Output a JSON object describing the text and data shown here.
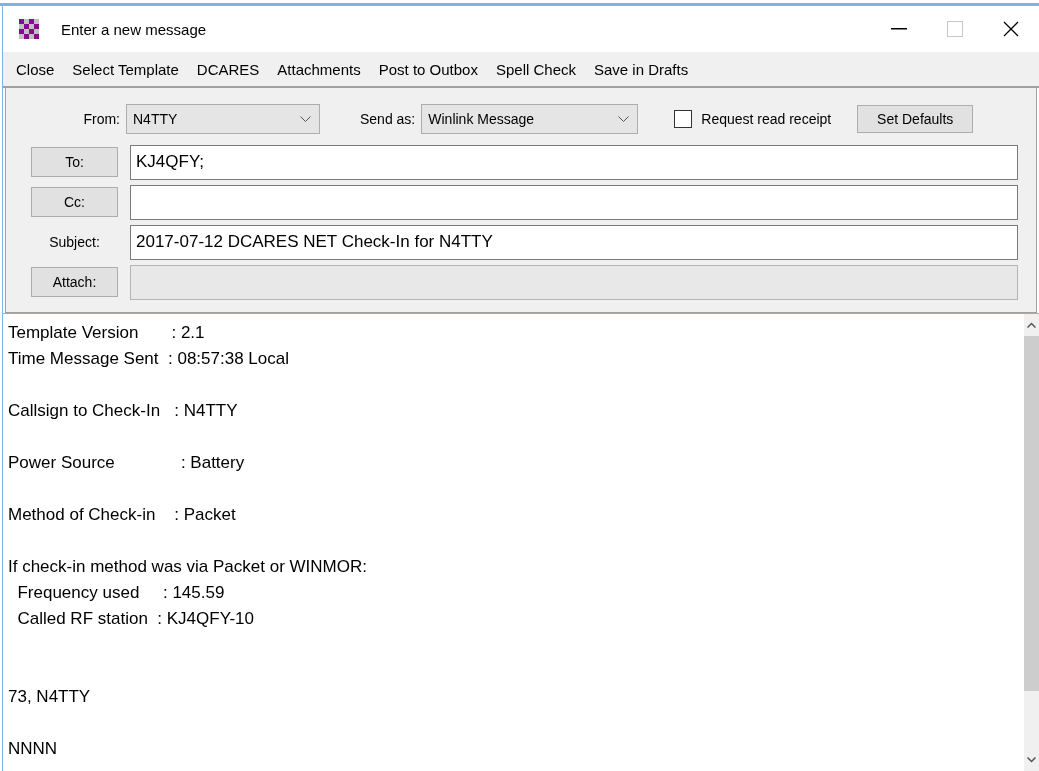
{
  "window": {
    "title": "Enter a new message"
  },
  "toolbar": [
    {
      "label": "Close"
    },
    {
      "label": "Select Template"
    },
    {
      "label": "DCARES"
    },
    {
      "label": "Attachments"
    },
    {
      "label": "Post to Outbox"
    },
    {
      "label": "Spell Check"
    },
    {
      "label": "Save in Drafts"
    }
  ],
  "header": {
    "from": {
      "label": "From:",
      "value": "N4TTY"
    },
    "send_as": {
      "label": "Send as:",
      "value": "Winlink Message"
    },
    "read_receipt": {
      "label": "Request read receipt",
      "checked": false
    },
    "set_defaults": "Set Defaults",
    "rows": [
      {
        "kind": "button",
        "label": "To:",
        "value": "KJ4QFY;",
        "disabled": false
      },
      {
        "kind": "button",
        "label": "Cc:",
        "disabled": false
      },
      {
        "kind": "label",
        "label": "Subject:",
        "value": "2017-07-12 DCARES NET Check-In for N4TTY",
        "disabled": false
      },
      {
        "kind": "button",
        "label": "Attach:",
        "disabled": true
      }
    ]
  },
  "body": [
    {
      "kind": "text",
      "text": "Template Version       : 2.1"
    },
    {
      "kind": "text",
      "text": "Time Message Sent  : 08:57:38 Local"
    },
    {
      "kind": "blank"
    },
    {
      "kind": "text",
      "text": "Callsign to Check-In   : N4TTY"
    },
    {
      "kind": "blank"
    },
    {
      "kind": "text",
      "text": "Power Source              : Battery"
    },
    {
      "kind": "blank"
    },
    {
      "kind": "text",
      "text": "Method of Check-in    : Packet"
    },
    {
      "kind": "blank"
    },
    {
      "kind": "text",
      "text": "If check-in method was via Packet or WINMOR:"
    },
    {
      "kind": "text",
      "text": "  Frequency used     : 145.59"
    },
    {
      "kind": "text",
      "text": "  Called RF station  : KJ4QFY-10"
    },
    {
      "kind": "blank"
    },
    {
      "kind": "blank"
    },
    {
      "kind": "text",
      "text": "73, N4TTY"
    },
    {
      "kind": "blank"
    },
    {
      "kind": "text",
      "text": "NNNN"
    }
  ]
}
